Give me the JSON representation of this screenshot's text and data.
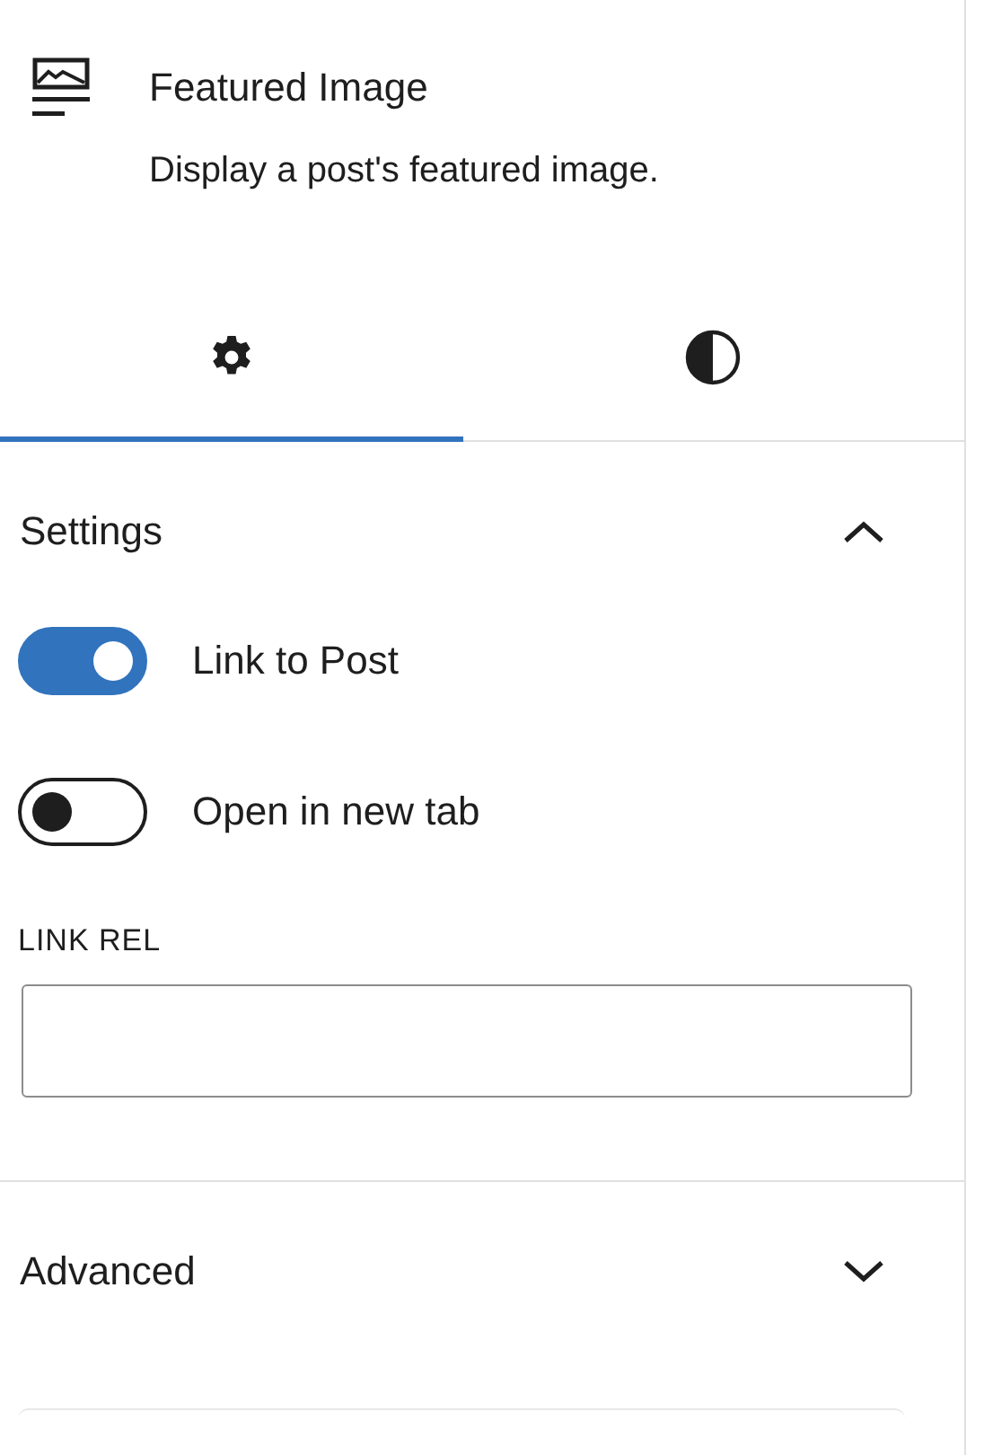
{
  "block": {
    "title": "Featured Image",
    "description": "Display a post's featured image."
  },
  "tabs": [
    {
      "kind": "settings",
      "selected": true
    },
    {
      "kind": "styles",
      "selected": false
    }
  ],
  "panels": [
    {
      "title": "Settings",
      "expanded": true,
      "toggles": [
        {
          "label": "Link to Post",
          "on": true
        },
        {
          "label": "Open in new tab",
          "on": false
        }
      ],
      "field": {
        "label": "LINK REL"
      }
    },
    {
      "title": "Advanced",
      "expanded": false
    }
  ]
}
